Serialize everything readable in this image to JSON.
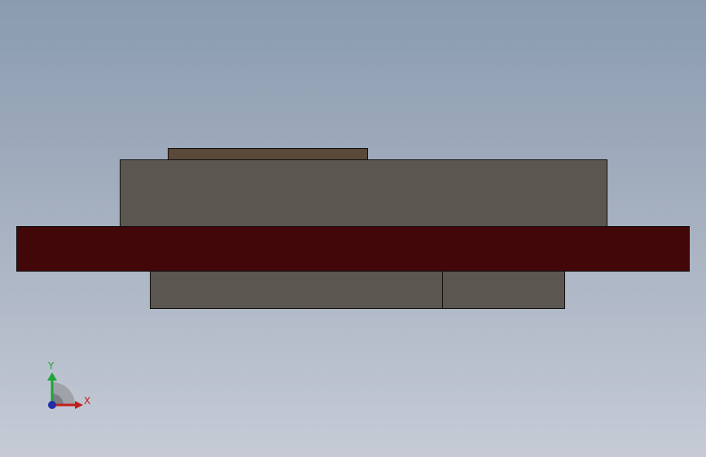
{
  "viewport": {
    "parts": {
      "top_plate_color": "#5a4838",
      "upper_block_color": "#5b5750",
      "flange_color": "#420709",
      "lower_block_left_color": "#5b5750",
      "lower_block_right_color": "#5b5750"
    },
    "triad": {
      "x_label": "X",
      "y_label": "Y",
      "x_color": "#c0201e",
      "y_color": "#1fa33a",
      "z_color": "#1f2fa8"
    }
  }
}
